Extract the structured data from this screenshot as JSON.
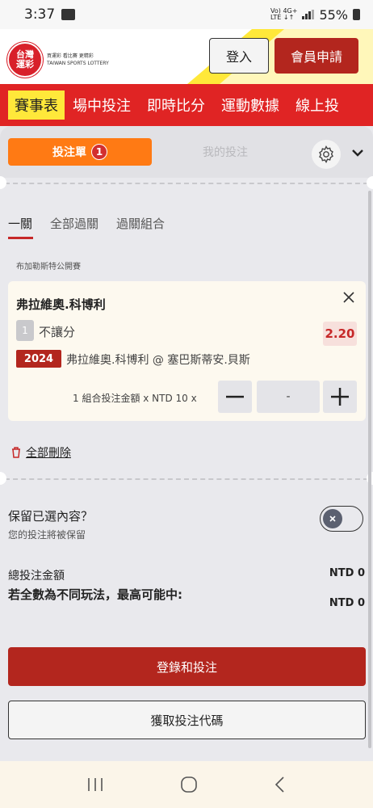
{
  "status_bar": {
    "time": "3:37",
    "network_top": "Vo) 4G+",
    "network_bottom": "LTE ↓↑",
    "battery": "55%"
  },
  "header": {
    "logo_badge": "台灣\n運彩",
    "logo_text_line1": "買運彩 看比賽 更精彩",
    "logo_text_line2": "TAIWAN SPORTS LOTTERY",
    "login_label": "登入",
    "register_label": "會員申請",
    "accent_color": "#ffe83a"
  },
  "nav": {
    "items": [
      "賽事表",
      "場中投注",
      "即時比分",
      "運動數據",
      "線上投"
    ]
  },
  "betslip": {
    "tab_slip": "投注單",
    "tab_slip_count": "1",
    "tab_mybets": "我的投注",
    "subtabs": [
      "一關",
      "全部過關",
      "過關組合"
    ],
    "league": "布加勒斯特公開賽",
    "selection": {
      "title": "弗拉維奧.科博利",
      "number": "1",
      "market": "不讓分",
      "odds": "2.20",
      "code": "2024",
      "matchup": "弗拉維奧.科博利 @ 塞巴斯蒂安.貝斯",
      "stake_label": "1 組合投注金額 x NTD 10 x",
      "stake_value": "-"
    },
    "delete_all": "全部刪除",
    "keep_title": "保留已選內容？",
    "keep_sub": "您的投注將被保留",
    "total_label": "總投注金額",
    "total_value": "NTD 0",
    "max_label": "若全數為不同玩法，最高可能中:",
    "max_value": "NTD 0",
    "primary_button": "登錄和投注",
    "secondary_button": "獲取投注代碼"
  }
}
